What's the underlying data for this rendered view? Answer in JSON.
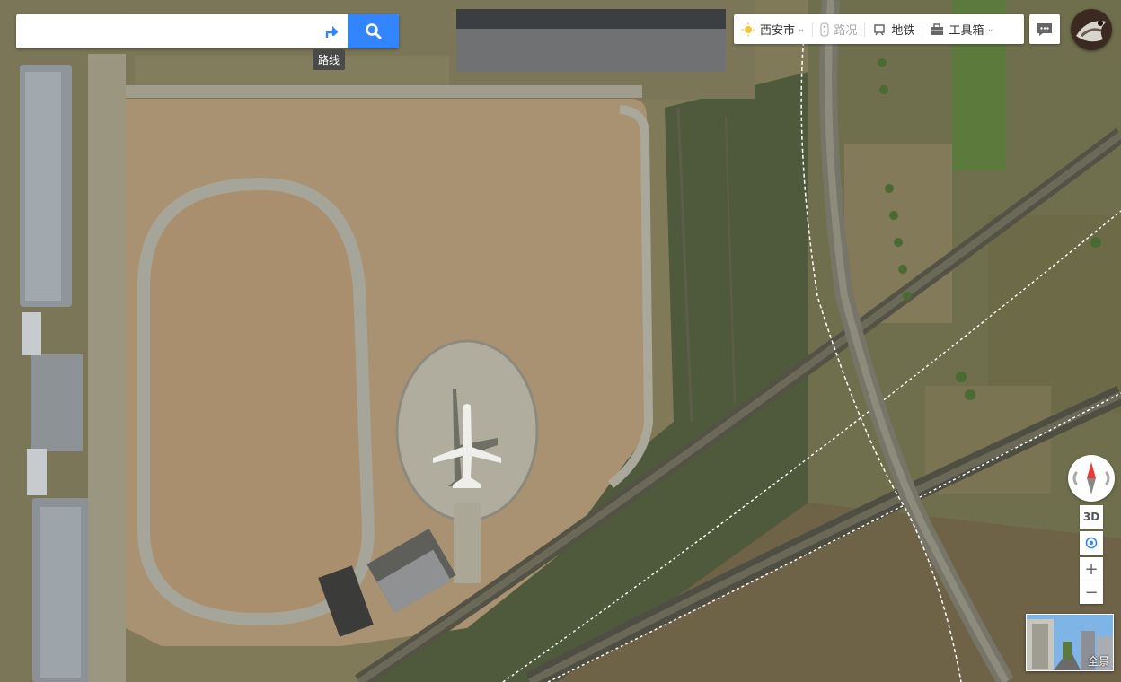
{
  "search": {
    "value": "",
    "placeholder": ""
  },
  "route": {
    "tooltip": "路线",
    "icon": "route-arrow-icon"
  },
  "toolbar": {
    "city": "西安市",
    "traffic": "路况",
    "subway": "地铁",
    "tools": "工具箱"
  },
  "controls": {
    "three_d": "3D",
    "zoom_in": "+",
    "zoom_out": "−"
  },
  "panorama": {
    "label": "全景"
  },
  "colors": {
    "accent": "#3385ff",
    "compass_north": "#e53b3b",
    "toolbar_bg": "#ffffff"
  },
  "icons": [
    "search-icon",
    "route-arrow-icon",
    "weather-sun-icon",
    "traffic-icon",
    "subway-icon",
    "toolbox-icon",
    "message-icon",
    "compass-icon",
    "locate-icon"
  ]
}
